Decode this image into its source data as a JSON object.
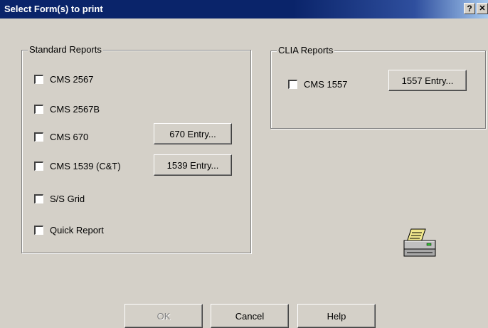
{
  "window": {
    "title": "Select Form(s) to print",
    "help_glyph": "?",
    "close_glyph": "✕"
  },
  "standard_reports": {
    "legend": "Standard Reports",
    "items": [
      {
        "label": "CMS 2567",
        "checked": false
      },
      {
        "label": "CMS 2567B",
        "checked": false
      },
      {
        "label": "CMS 670",
        "checked": false
      },
      {
        "label": "CMS 1539 (C&T)",
        "checked": false
      },
      {
        "label": "S/S Grid",
        "checked": false
      },
      {
        "label": "Quick Report",
        "checked": false
      }
    ],
    "entry_670_label": "670 Entry...",
    "entry_1539_label": "1539 Entry..."
  },
  "clia_reports": {
    "legend": "CLIA Reports",
    "items": [
      {
        "label": "CMS 1557",
        "checked": false
      }
    ],
    "entry_1557_label": "1557 Entry..."
  },
  "footer": {
    "ok_label": "OK",
    "ok_enabled": false,
    "cancel_label": "Cancel",
    "help_label": "Help"
  },
  "icons": {
    "printer": "printer-icon"
  },
  "colors": {
    "titlebar": "#0a246a",
    "dialog_bg": "#d4d0c8",
    "printer_paper": "#f0e68c",
    "printer_led": "#2ec22e"
  }
}
